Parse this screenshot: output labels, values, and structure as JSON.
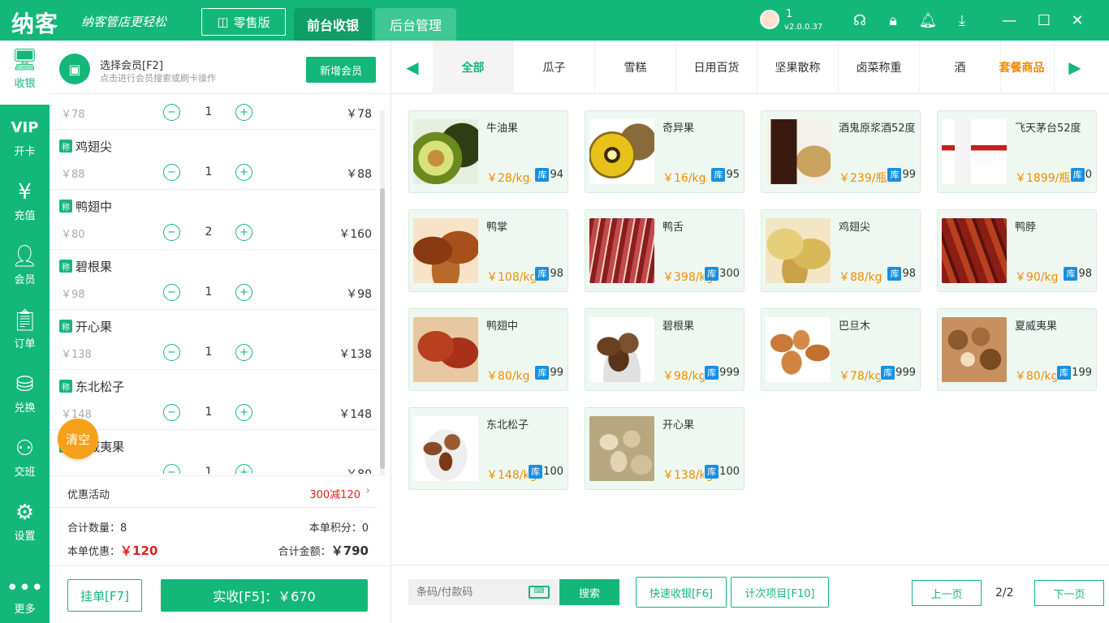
{
  "app": {
    "logo": "纳客",
    "slogan": "纳客管店更轻松",
    "edition": "零售版",
    "tabs": [
      "前台收银",
      "后台管理"
    ],
    "user": {
      "name": "1",
      "version": "v2.0.0.37"
    }
  },
  "sidebar": [
    {
      "label": "收银",
      "icon": "monitor-icon"
    },
    {
      "label": "开卡",
      "icon": "vip-icon"
    },
    {
      "label": "充值",
      "icon": "recharge-icon"
    },
    {
      "label": "会员",
      "icon": "member-icon"
    },
    {
      "label": "订单",
      "icon": "order-icon"
    },
    {
      "label": "兑换",
      "icon": "exchange-icon"
    },
    {
      "label": "交班",
      "icon": "shift-icon"
    },
    {
      "label": "设置",
      "icon": "settings-icon"
    },
    {
      "label": "更多",
      "icon": "more-icon"
    }
  ],
  "member": {
    "title": "选择会员[F2]",
    "subtitle": "点击进行会员搜索或刷卡操作",
    "new_button": "新增会员"
  },
  "cart": {
    "badge": "称",
    "items": [
      {
        "name": "",
        "price": "￥78",
        "qty": "1",
        "subtotal": "￥78"
      },
      {
        "name": "鸡翅尖",
        "price": "￥88",
        "qty": "1",
        "subtotal": "￥88"
      },
      {
        "name": "鸭翅中",
        "price": "￥80",
        "qty": "2",
        "subtotal": "￥160"
      },
      {
        "name": "碧根果",
        "price": "￥98",
        "qty": "1",
        "subtotal": "￥98"
      },
      {
        "name": "开心果",
        "price": "￥138",
        "qty": "1",
        "subtotal": "￥138"
      },
      {
        "name": "东北松子",
        "price": "￥148",
        "qty": "1",
        "subtotal": "￥148"
      },
      {
        "name": "夏威夷果",
        "price": "",
        "qty": "1",
        "subtotal": "￥80"
      }
    ],
    "clear": "清空"
  },
  "promo": {
    "label": "优惠活动",
    "value": "300减120"
  },
  "totals": {
    "qty_label": "合计数量：",
    "qty": "8",
    "points_label": "本单积分：",
    "points": "0",
    "discount_label": "本单优惠：",
    "discount": "￥120",
    "amount_label": "合计金额：",
    "amount": "￥790"
  },
  "actions": {
    "hold": "挂单[F7]",
    "pay": "实收[F5]：￥670"
  },
  "categories": [
    "全部",
    "瓜子",
    "雪糕",
    "日用百货",
    "坚果散称",
    "卤菜称重",
    "酒",
    "套餐商品"
  ],
  "products": [
    {
      "name": "牛油果",
      "price": "￥28/kg",
      "stock": "94",
      "img": "avocado"
    },
    {
      "name": "奇异果",
      "price": "￥16/kg",
      "stock": "95",
      "img": "kiwi"
    },
    {
      "name": "酒鬼原浆酒52度",
      "price": "￥239/瓶",
      "stock": "99",
      "img": "liquor"
    },
    {
      "name": "飞天茅台52度",
      "price": "￥1899/瓶",
      "stock": "0",
      "img": "maotai"
    },
    {
      "name": "鸭掌",
      "price": "￥108/kg",
      "stock": "98",
      "img": "duck-feet"
    },
    {
      "name": "鸭舌",
      "price": "￥398/kg",
      "stock": "300",
      "img": "duck-tongue"
    },
    {
      "name": "鸡翅尖",
      "price": "￥88/kg",
      "stock": "98",
      "img": "wing-tip"
    },
    {
      "name": "鸭脖",
      "price": "￥90/kg",
      "stock": "98",
      "img": "duck-neck"
    },
    {
      "name": "鸭翅中",
      "price": "￥80/kg",
      "stock": "99",
      "img": "duck-wing"
    },
    {
      "name": "碧根果",
      "price": "￥98/kg",
      "stock": "999",
      "img": "pecan"
    },
    {
      "name": "巴旦木",
      "price": "￥78/kg",
      "stock": "999",
      "img": "almond"
    },
    {
      "name": "夏威夷果",
      "price": "￥80/kg",
      "stock": "199",
      "img": "macadamia"
    },
    {
      "name": "东北松子",
      "price": "￥148/kg",
      "stock": "100",
      "img": "pine-nut"
    },
    {
      "name": "开心果",
      "price": "￥138/kg",
      "stock": "100",
      "img": "pistachio"
    }
  ],
  "stock_badge": "库",
  "bottom": {
    "scan_placeholder": "条码/付款码",
    "search": "搜索",
    "quick": "快速收银[F6]",
    "count_items": "计次项目[F10]",
    "prev": "上一页",
    "page": "2/2",
    "next": "下一页"
  },
  "colors": {
    "primary": "#14b77a",
    "price": "#f08c00",
    "discount": "#e02020",
    "clear": "#f7a11b",
    "stock": "#1a8fe0"
  }
}
